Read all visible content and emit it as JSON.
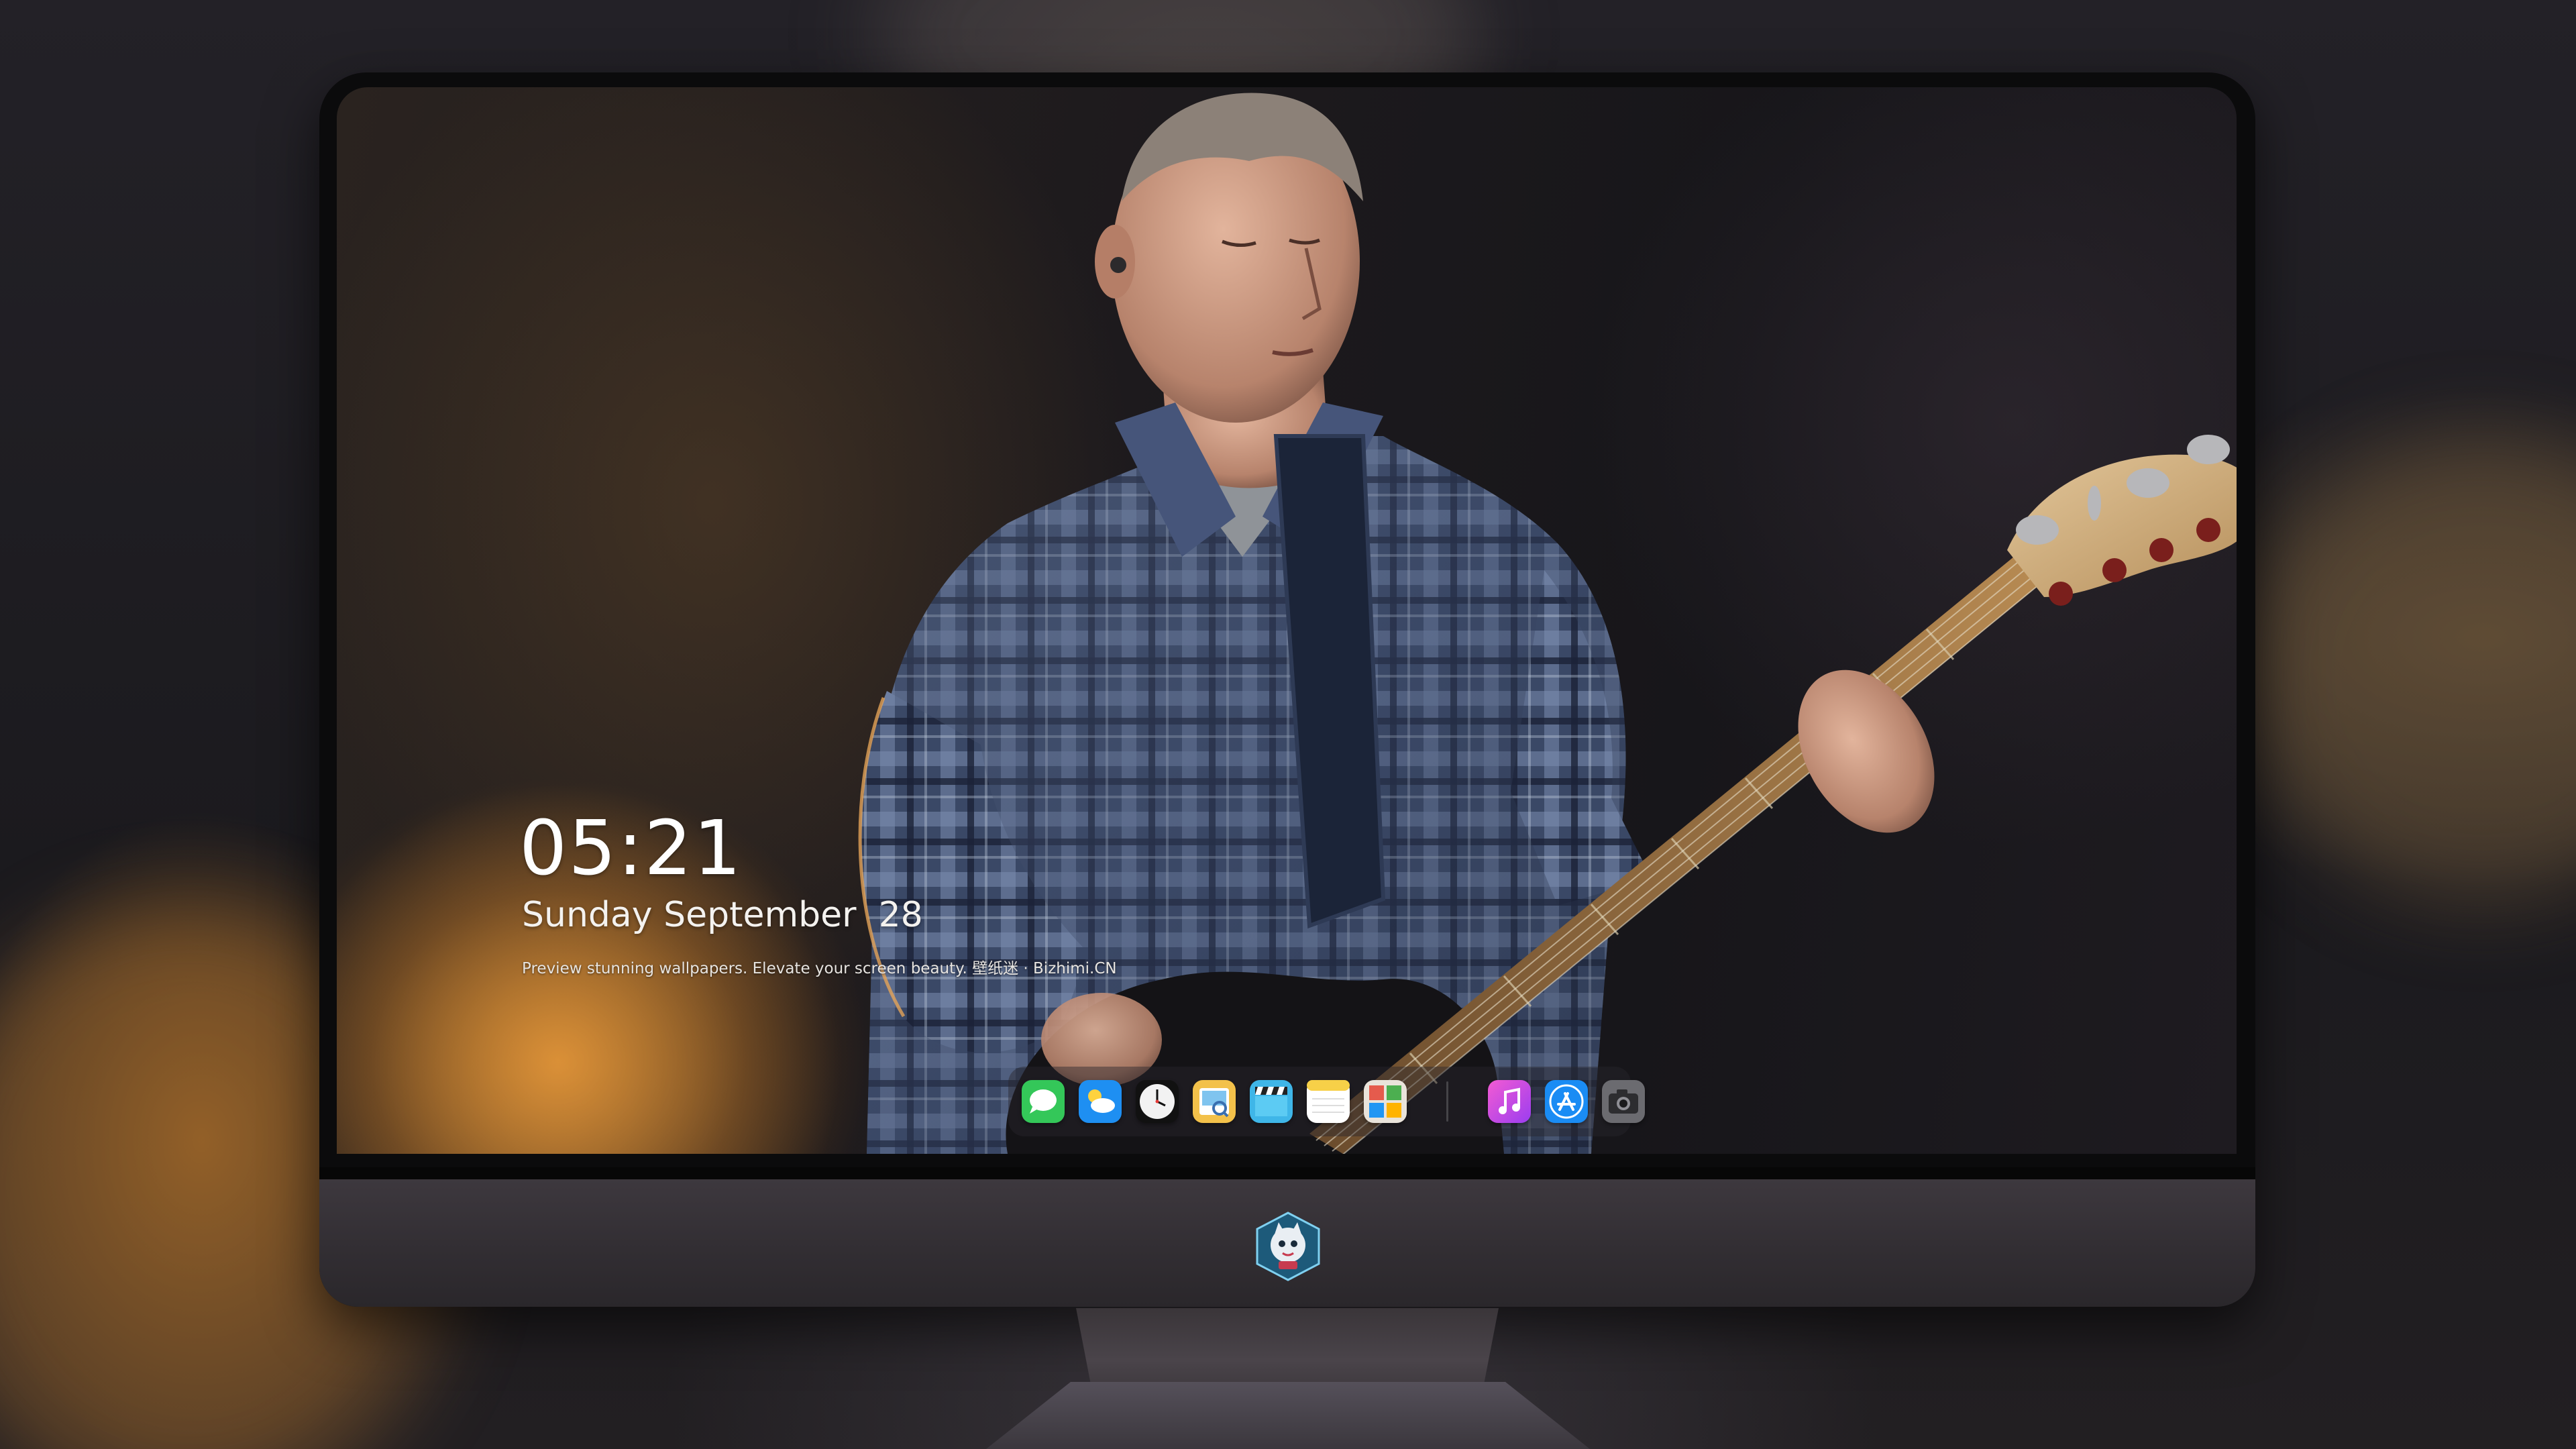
{
  "lockscreen": {
    "time": "05:21",
    "date": "Sunday September  28",
    "tagline": "Preview stunning wallpapers. Elevate your screen beauty. 壁纸迷 · Bizhimi.CN"
  },
  "dock": {
    "apps": [
      {
        "icon": "messages-icon",
        "color": "#34c759"
      },
      {
        "icon": "weather-icon",
        "color": "#1e8ff2"
      },
      {
        "icon": "clock-icon",
        "color": "#f2f2f2"
      },
      {
        "icon": "preview-icon",
        "color": "#f3c14a"
      },
      {
        "icon": "clips-icon",
        "color": "#3fb6e8"
      },
      {
        "icon": "notes-icon",
        "color": "#f7d048"
      },
      {
        "icon": "photo-booth-icon",
        "color": "#e9e3da"
      },
      {
        "icon": "music-icon",
        "color": "#e14fd8"
      },
      {
        "icon": "app-store-icon",
        "color": "#1a8cf4"
      },
      {
        "icon": "camera-icon",
        "color": "#6b6b70"
      }
    ]
  },
  "chin": {
    "logo": "mascot-logo-icon"
  },
  "colors": {
    "accent_glow": "#d98a2b",
    "screen_bg": "#1b181c"
  }
}
